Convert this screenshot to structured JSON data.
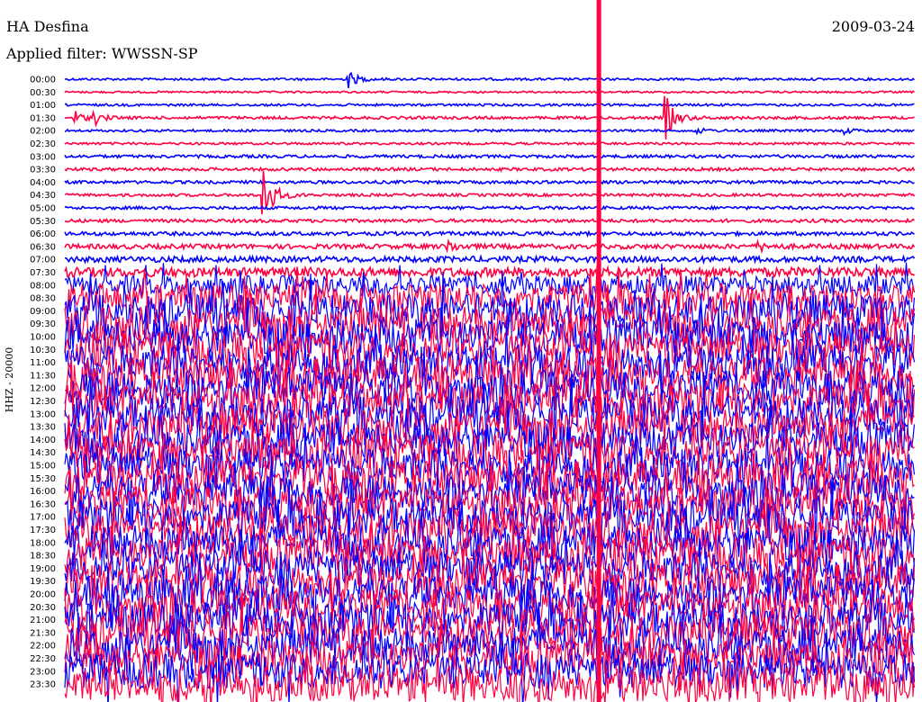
{
  "header": {
    "station": "HA Desfina",
    "filter": "Applied filter: WWSSN-SP",
    "date": "2009-03-24"
  },
  "chart_data": {
    "type": "line",
    "title": "HA Desfina",
    "subtitle": "Applied filter: WWSSN-SP",
    "ylabel": "HHZ - 20000",
    "xlabel": "",
    "x_range_minutes": [
      0,
      30
    ],
    "row_labels": [
      "00:00",
      "00:30",
      "01:00",
      "01:30",
      "02:00",
      "02:30",
      "03:00",
      "03:30",
      "04:00",
      "04:30",
      "05:00",
      "05:30",
      "06:00",
      "06:30",
      "07:00",
      "07:30",
      "08:00",
      "08:30",
      "09:00",
      "09:30",
      "10:00",
      "10:30",
      "11:00",
      "11:30",
      "12:00",
      "12:30",
      "13:00",
      "13:30",
      "14:00",
      "14:30",
      "15:00",
      "15:30",
      "16:00",
      "16:30",
      "17:00",
      "17:30",
      "18:00",
      "18:30",
      "19:00",
      "19:30",
      "20:00",
      "20:30",
      "21:00",
      "21:30",
      "22:00",
      "22:30",
      "23:00",
      "23:30"
    ],
    "colors": [
      "#0000ff",
      "#ff0040"
    ],
    "relative_noise_amplitude": [
      1,
      0.8,
      1,
      1.2,
      1,
      1,
      1.3,
      1.3,
      1.3,
      1.2,
      1.3,
      1.4,
      1.6,
      2,
      2.5,
      4,
      8,
      12,
      14,
      15,
      15,
      15,
      15,
      15,
      15,
      15,
      15,
      15,
      15,
      15,
      15,
      15,
      15,
      15,
      15,
      15,
      15,
      15,
      15,
      15,
      15,
      15,
      15,
      15,
      15,
      15,
      15,
      15
    ],
    "events": [
      {
        "row": 0,
        "minute": 10.0,
        "amplitude": 12
      },
      {
        "row": 3,
        "minute": 0.35,
        "amplitude": 8
      },
      {
        "row": 3,
        "minute": 1.05,
        "amplitude": 7
      },
      {
        "row": 3,
        "minute": 21.2,
        "amplitude": 30
      },
      {
        "row": 4,
        "minute": 22.3,
        "amplitude": 4
      },
      {
        "row": 4,
        "minute": 27.5,
        "amplitude": 4
      },
      {
        "row": 9,
        "minute": 7.0,
        "amplitude": 50
      },
      {
        "row": 13,
        "minute": 13.5,
        "amplitude": 8
      },
      {
        "row": 13,
        "minute": 24.5,
        "amplitude": 6
      }
    ],
    "glitch": {
      "minute": 18.85,
      "color": "#ff0040"
    }
  }
}
